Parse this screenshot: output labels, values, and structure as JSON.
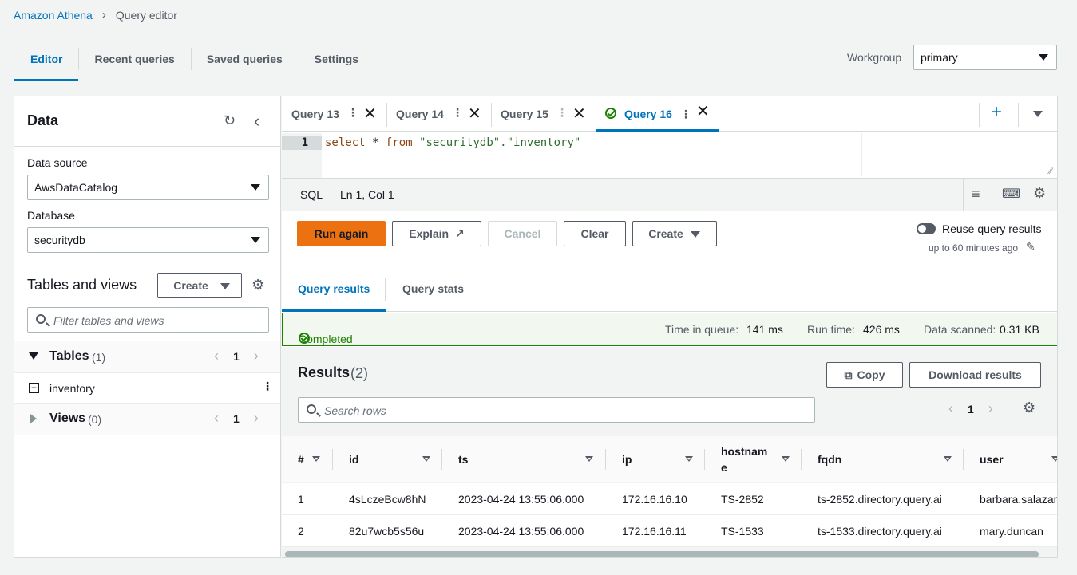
{
  "breadcrumb": {
    "root": "Amazon Athena",
    "current": "Query editor"
  },
  "top_tabs": [
    "Editor",
    "Recent queries",
    "Saved queries",
    "Settings"
  ],
  "workgroup": {
    "label": "Workgroup",
    "value": "primary"
  },
  "data_panel": {
    "title": "Data",
    "data_source_label": "Data source",
    "data_source_value": "AwsDataCatalog",
    "database_label": "Database",
    "database_value": "securitydb",
    "tables_views_title": "Tables and views",
    "create_label": "Create",
    "filter_placeholder": "Filter tables and views",
    "tables_label": "Tables",
    "tables_count": "(1)",
    "tables_page": "1",
    "table_items": [
      "inventory"
    ],
    "views_label": "Views",
    "views_count": "(0)",
    "views_page": "1"
  },
  "query_tabs": [
    "Query 13",
    "Query 14",
    "Query 15",
    "Query 16"
  ],
  "editor": {
    "line_number": "1",
    "code_kw1": "select",
    "code_mid": " * ",
    "code_kw2": "from",
    "code_space": " ",
    "code_str": "\"securitydb\".\"inventory\"",
    "language": "SQL",
    "cursor": "Ln 1, Col 1"
  },
  "actions": {
    "run": "Run again",
    "explain": "Explain",
    "cancel": "Cancel",
    "clear": "Clear",
    "create": "Create",
    "reuse_label": "Reuse query results",
    "reuse_sub": "up to 60 minutes ago"
  },
  "result_tabs": [
    "Query results",
    "Query stats"
  ],
  "status": {
    "text": "Completed",
    "queue_label": "Time in queue:",
    "queue_value": "141 ms",
    "run_label": "Run time:",
    "run_value": "426 ms",
    "scanned_label": "Data scanned:",
    "scanned_value": "0.31 KB"
  },
  "results": {
    "title": "Results",
    "count": "(2)",
    "copy": "Copy",
    "download": "Download results",
    "search_placeholder": "Search rows",
    "page": "1",
    "columns": [
      "#",
      "id",
      "ts",
      "ip",
      "hostname",
      "fqdn",
      "user"
    ],
    "rows": [
      [
        "1",
        "4sLczeBcw8hN",
        "2023-04-24 13:55:06.000",
        "172.16.16.10",
        "TS-2852",
        "ts-2852.directory.query.ai",
        "barbara.salazar"
      ],
      [
        "2",
        "82u7wcb5s56u",
        "2023-04-24 13:55:06.000",
        "172.16.16.11",
        "TS-1533",
        "ts-1533.directory.query.ai",
        "mary.duncan"
      ]
    ]
  },
  "colors": {
    "accent": "#0073bb",
    "primary_button": "#ec7211",
    "success": "#1d8102"
  }
}
